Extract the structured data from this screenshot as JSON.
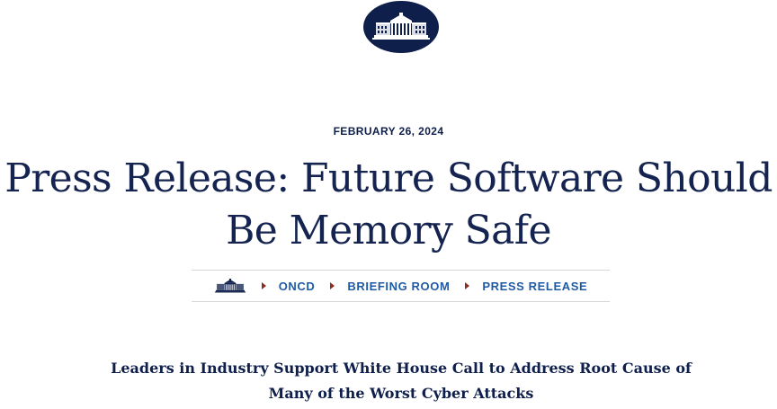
{
  "header": {
    "logo_icon": "white-house-icon"
  },
  "article": {
    "date": "FEBRUARY 26, 2024",
    "title_line1": "Press Release: Future Software Should",
    "title_line2": "Be Memory Safe",
    "subtitle_line1": "Leaders in Industry Support White House Call to Address Root Cause of",
    "subtitle_line2": "Many of the Worst Cyber Attacks"
  },
  "breadcrumb": {
    "home_icon": "white-house-icon",
    "items": [
      "ONCD",
      "BRIEFING ROOM",
      "PRESS RELEASE"
    ]
  },
  "colors": {
    "navy": "#0f1f4b",
    "link": "#1f5aa6",
    "separator": "#8b2d1f",
    "rule": "#d6d6d6"
  }
}
